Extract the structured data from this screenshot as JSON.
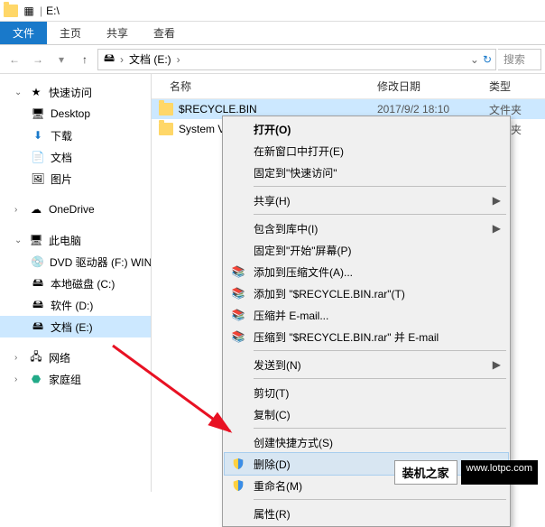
{
  "title": "E:\\",
  "ribbon": {
    "file": "文件",
    "home": "主页",
    "share": "共享",
    "view": "查看"
  },
  "breadcrumb": {
    "root": "文档 (E:)",
    "chev": "›"
  },
  "search": {
    "placeholder": "搜索"
  },
  "columns": {
    "name": "名称",
    "date": "修改日期",
    "type": "类型"
  },
  "sidebar": {
    "quick": "快速访问",
    "desktop": "Desktop",
    "downloads": "下载",
    "docs": "文档",
    "pics": "图片",
    "onedrive": "OneDrive",
    "thispc": "此电脑",
    "dvd": "DVD 驱动器 (F:) WIN",
    "localc": "本地磁盘 (C:)",
    "softd": "软件 (D:)",
    "doce": "文档 (E:)",
    "network": "网络",
    "homegroup": "家庭组"
  },
  "rows": [
    {
      "name": "$RECYCLE.BIN",
      "date": "2017/9/2 18:10",
      "type": "文件夹"
    },
    {
      "name": "System V",
      "date": "",
      "type": "文件夹"
    }
  ],
  "ctx": {
    "open": "打开(O)",
    "newwin": "在新窗口中打开(E)",
    "pin": "固定到\"快速访问\"",
    "share": "共享(H)",
    "include": "包含到库中(I)",
    "pinstart": "固定到\"开始\"屏幕(P)",
    "addzip": "添加到压缩文件(A)...",
    "addrar": "添加到 \"$RECYCLE.BIN.rar\"(T)",
    "zipmail": "压缩并 E-mail...",
    "zipmailto": "压缩到 \"$RECYCLE.BIN.rar\" 并 E-mail",
    "sendto": "发送到(N)",
    "cut": "剪切(T)",
    "copy": "复制(C)",
    "shortcut": "创建快捷方式(S)",
    "delete": "删除(D)",
    "rename": "重命名(M)",
    "prop": "属性(R)"
  },
  "watermark": {
    "brand": "装机之家",
    "url": "www.lotpc.com"
  }
}
